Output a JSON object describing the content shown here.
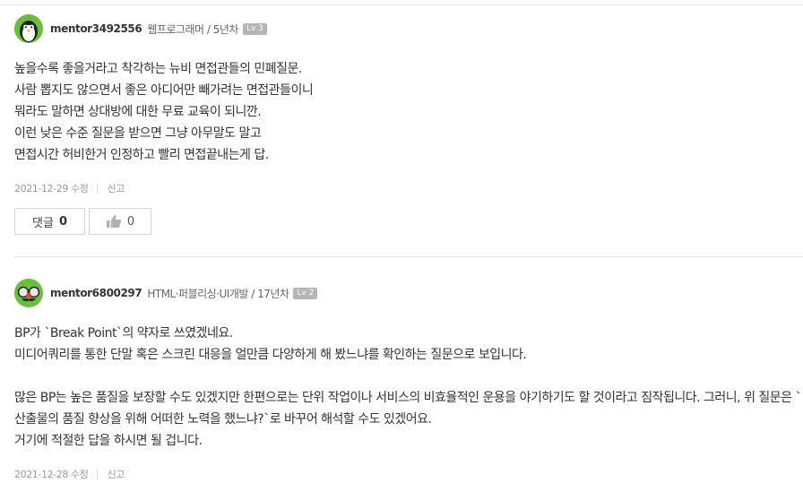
{
  "answers": [
    {
      "username": "mentor3492556",
      "meta": "웹프로그래머 / 5년차",
      "level": "Lv 3",
      "lines": [
        "높을수록 좋을거라고 착각하는 뉴비 면접관들의 민폐질문.",
        "사람 뽑지도 않으면서 좋은 아디어만 빼가려는 면접관들이니",
        "뭐라도 말하면 상대방에 대한 무료 교육이 되니깐.",
        "이런 낮은 수준 질문을 받으면 그냥 아무말도 말고",
        "면접시간 허비한거 인정하고 빨리 면접끝내는게 답."
      ],
      "date": "2021-12-29 수정",
      "report_label": "신고",
      "comment_label": "댓글",
      "comment_count": "0",
      "like_count": "0",
      "avatar_icon": "penguin-icon"
    },
    {
      "username": "mentor6800297",
      "meta": "HTML·퍼블리싱·UI개발 / 17년차",
      "level": "Lv 2",
      "line1": "BP가 `Break Point`의 약자로 쓰였겠네요.",
      "line2": "미디어쿼리를 통한 단말 혹은 스크린 대응을 얼만큼 다양하게 해 봤느냐를 확인하는 질문으로 보입니다.",
      "para2": "많은 BP는 높은 품질을 보장할 수도 있겠지만 한편으로는 단위 작업이나 서비스의 비효율적인 운용을 야기하기도 할 것이라고 짐작됩니다. 그러니, 위 질문은 `산출물의 품질 향상을 위해 어떠한 노력을 했느냐?`로 바꾸어 해석할 수도 있겠어요.",
      "line5": "거기에 적절한 답을 하시면 될 겁니다.",
      "date": "2021-12-28 수정",
      "report_label": "신고",
      "avatar_icon": "disguise-glasses-icon"
    }
  ],
  "icons": {
    "thumbs_up": "thumbs-up-icon"
  },
  "colors": {
    "avatar_green": "#6bbf3f",
    "level_badge": "#b5b5b5",
    "border": "#d5d5d5"
  }
}
